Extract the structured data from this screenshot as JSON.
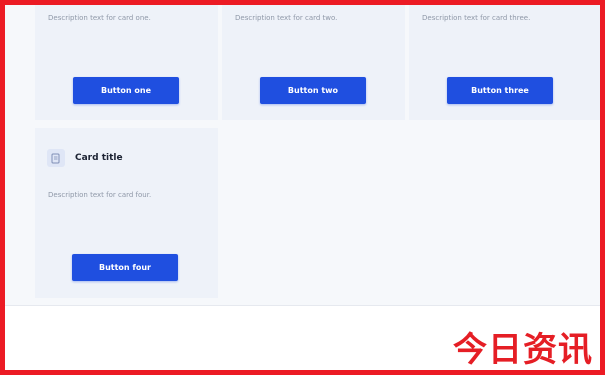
{
  "cards": [
    {
      "description": "Description text for card one.",
      "button_label": "Button one"
    },
    {
      "description": "Description text for card two.",
      "button_label": "Button two"
    },
    {
      "description": "Description text for card three.",
      "button_label": "Button three"
    },
    {
      "title": "Card title",
      "icon": "document-shield-icon",
      "description": "Description text for card four.",
      "button_label": "Button four"
    }
  ],
  "brand": {
    "watermark": "今日资讯",
    "color": "#e51e25"
  },
  "colors": {
    "accent": "#1f4fe0",
    "frame": "#ec1b24",
    "card_bg": "#eef2f9"
  }
}
